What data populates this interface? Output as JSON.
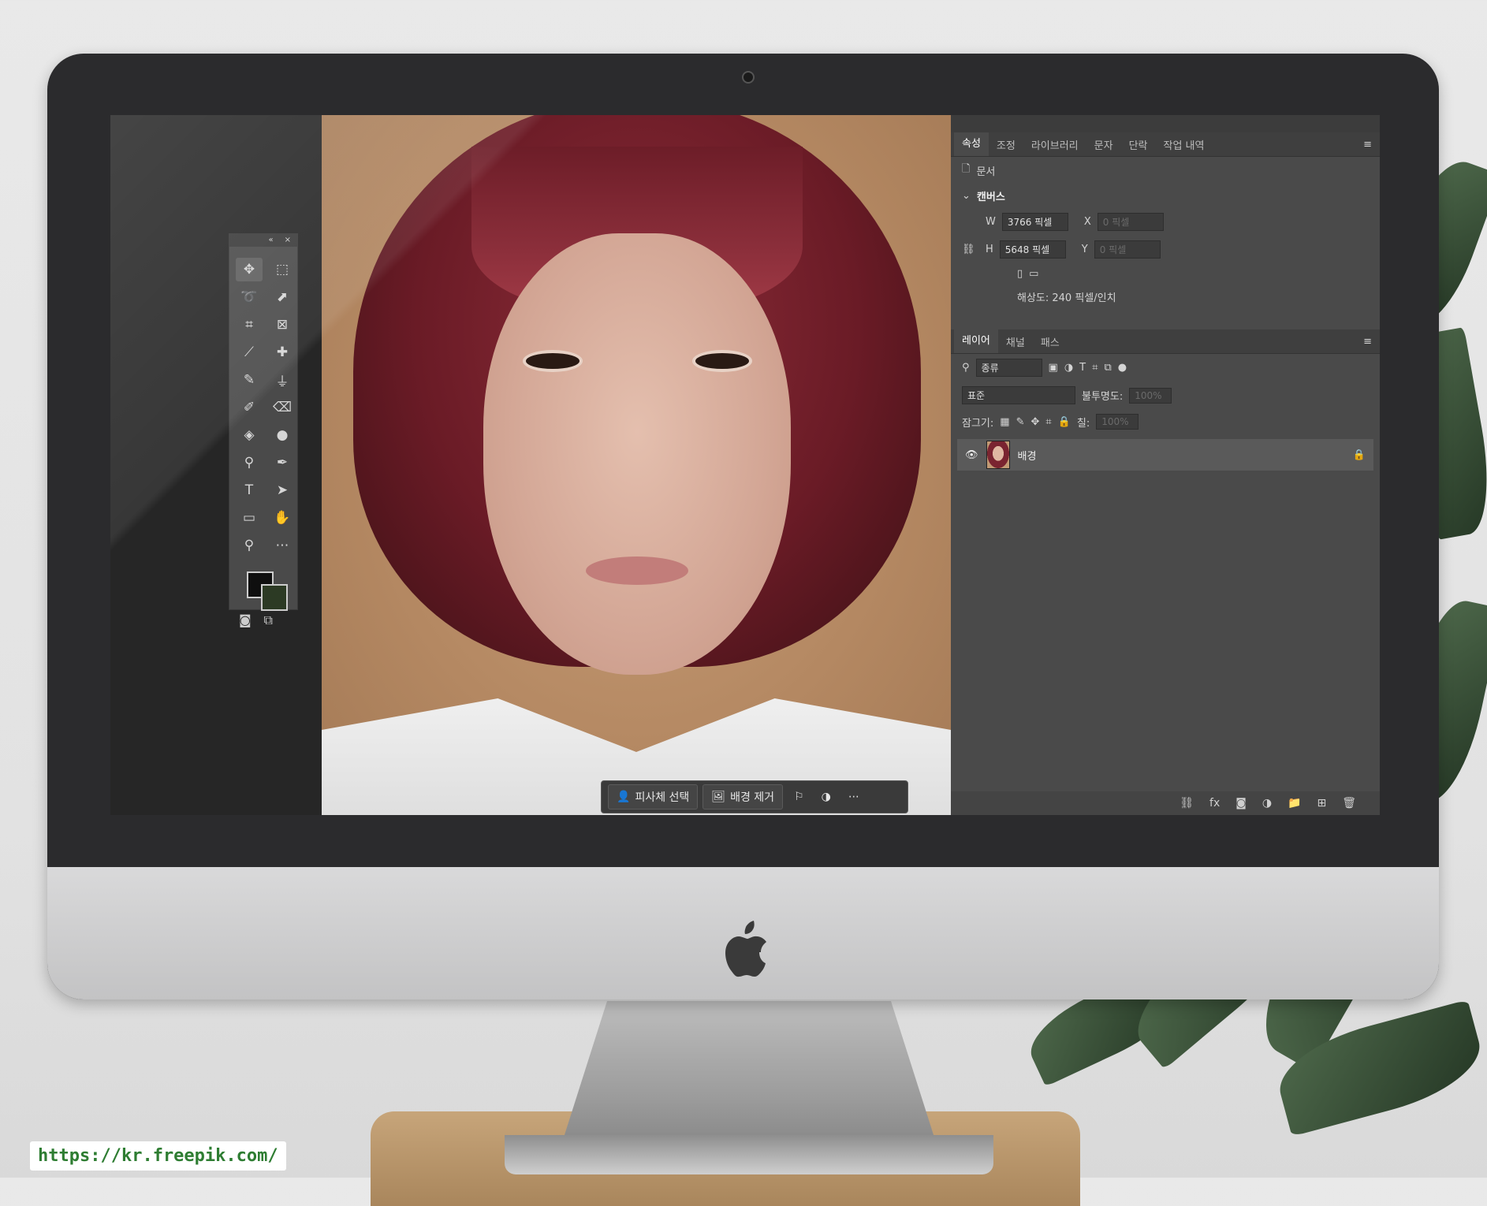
{
  "tools": [
    "move-tool",
    "marquee-tool",
    "lasso-tool",
    "quick-select-tool",
    "crop-tool",
    "frame-tool",
    "eyedropper-tool",
    "healing-tool",
    "brush-tool",
    "stamp-tool",
    "history-brush-tool",
    "eraser-tool",
    "bucket-tool",
    "blur-tool",
    "dodge-tool",
    "pen-tool",
    "type-tool",
    "path-select-tool",
    "rectangle-tool",
    "hand-tool",
    "zoom-tool",
    "more-tools"
  ],
  "context_bar": {
    "select_subject": "피사체 선택",
    "remove_bg": "배경 제거"
  },
  "properties": {
    "tabs": [
      "속성",
      "조정",
      "라이브러리",
      "문자",
      "단락",
      "작업 내역"
    ],
    "document_label": "문서",
    "canvas_title": "캔버스",
    "w_label": "W",
    "w_value": "3766 픽셀",
    "h_label": "H",
    "h_value": "5648 픽셀",
    "x_label": "X",
    "x_value": "0 픽셀",
    "y_label": "Y",
    "y_value": "0 픽셀",
    "resolution": "해상도: 240 픽셀/인치"
  },
  "layers": {
    "tabs": [
      "레이어",
      "채널",
      "패스"
    ],
    "filter_label": "종류",
    "blend_mode": "표준",
    "opacity_label": "불투명도:",
    "opacity_value": "100%",
    "lock_label": "잠그기:",
    "fill_label": "칠:",
    "fill_value": "100%",
    "items": [
      {
        "name": "배경"
      }
    ]
  },
  "watermark": "https://kr.freepik.com/"
}
